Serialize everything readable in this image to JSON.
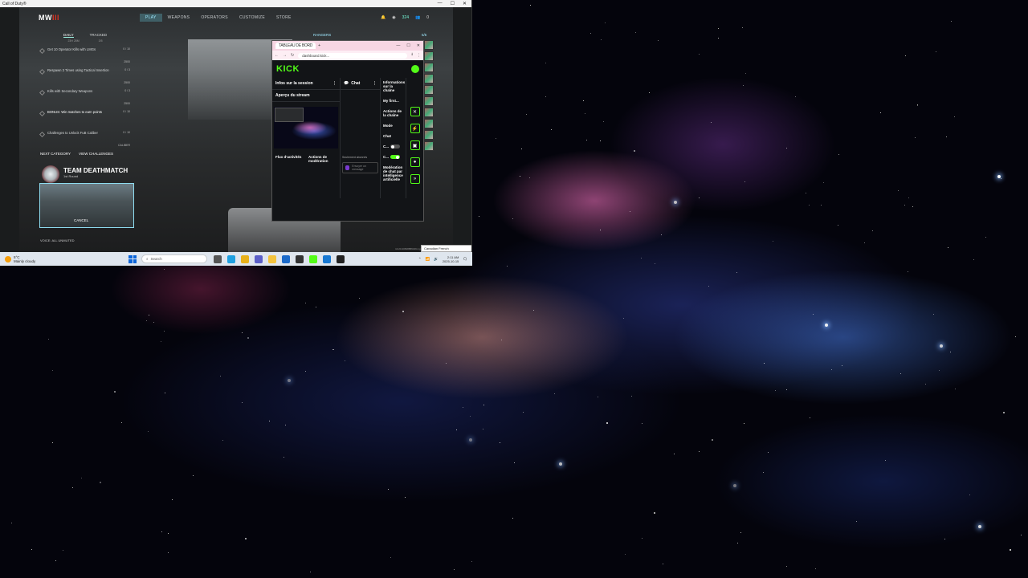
{
  "game": {
    "window_title": "Call of Duty®",
    "logo_main": "MW",
    "logo_accent": "III",
    "nav": [
      "PLAY",
      "WEAPONS",
      "OPERATORS",
      "CUSTOMIZE",
      "STORE"
    ],
    "active_nav": "PLAY",
    "currency": "324",
    "party_count": "0",
    "challenges": {
      "tabs": [
        "DAILY",
        "TRACKED"
      ],
      "tab_subs": [
        "23H 28M",
        "3/5"
      ],
      "items": [
        {
          "text": "Get 10 Operator Kills with LMGs",
          "progress": "0 / 10",
          "reward": "2500"
        },
        {
          "text": "Respawn 3 Times using Tactical Insertion",
          "progress": "0 / 3",
          "reward": "2500"
        },
        {
          "text": "Kills with Secondary Weapons",
          "progress": "0 / 3",
          "reward": "2500"
        },
        {
          "text": "BONUS: Win matches to earn points",
          "progress": "0 / 10",
          "reward": ""
        },
        {
          "text": "Challenges to Unlock FuB Caliber",
          "progress": "0 / 10",
          "reward": "CALIBER"
        }
      ],
      "next_category": "NEXT CATEGORY",
      "view_challenges": "VIEW CHALLENGES"
    },
    "mode": {
      "title": "TEAM DEATHMATCH",
      "subtitle": "1st Round",
      "cancel": "CANCEL"
    },
    "voice": "VOICE: ALL UNMUTED",
    "rangers": "RANGERS",
    "rangers_count": "5/5",
    "build": "10.20.20848886049.2.pc.0.0.pl.1.1.1000"
  },
  "browser": {
    "tab_title": "TABLEAU DE BORD",
    "url": "dashboard.kick...",
    "kick_logo": "KICK",
    "panels": {
      "session": "Infos sur la session",
      "preview": "Aperçu du stream",
      "chat": "Chat",
      "info": "Informations sur la chaîne",
      "activity": "Flux d'activités",
      "moderation": "Actions de modération",
      "followers_only": "Seulement abonnés",
      "chat_input": "Envoyer un message",
      "info_items": [
        "My first...",
        "Actions de la chaîne",
        "Mode",
        "Chat",
        "C...",
        "C...",
        "Modération de chat par intelligence artificielle"
      ]
    }
  },
  "taskbar": {
    "temp": "5°C",
    "weather": "Mainly cloudy",
    "search": "Search",
    "time": "2:11 AM",
    "date": "2025-10-15",
    "lang": "Canadian French"
  },
  "colors": {
    "kick_green": "#53fc18",
    "game_accent": "#9fe9ff"
  }
}
